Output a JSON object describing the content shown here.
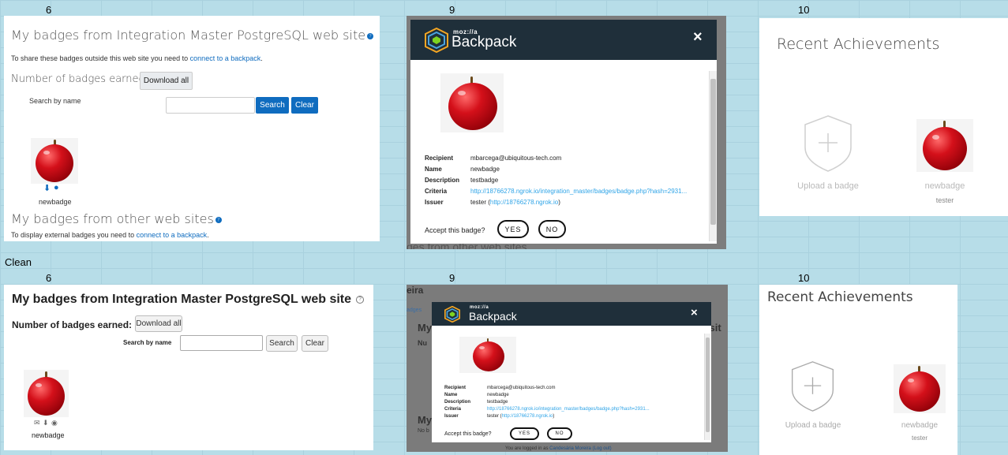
{
  "sheet": {
    "col_top": [
      "6",
      "9",
      "10"
    ],
    "col_bottom": [
      "6",
      "9",
      "10"
    ],
    "row_label": "Clean"
  },
  "boost": {
    "title": "My badges from Integration Master PostgreSQL web site",
    "share_text": "To share these badges outside this web site you need to",
    "share_link": "connect to a backpack",
    "share_end": ".",
    "earned_label": "Number of badges earned: 1",
    "download_all": "Download all",
    "search_label": "Search by name",
    "search_btn": "Search",
    "clear_btn": "Clear",
    "badge_name": "newbadge",
    "other_title": "My badges from other web sites",
    "display_text": "To display external badges you need to",
    "display_link": "connect to a backpack",
    "display_end": "."
  },
  "backpack_top": {
    "moz": "moz://a",
    "brand": "Backpack",
    "close": "×",
    "labels": {
      "recipient": "Recipient",
      "name": "Name",
      "description": "Description",
      "criteria": "Criteria",
      "issuer": "Issuer"
    },
    "recipient": "mbarcega@ubiquitous-tech.com",
    "name": "newbadge",
    "description": "testbadge",
    "criteria": "http://18766278.ngrok.io/integration_master/badges/badge.php?hash=2931...",
    "issuer_name": "tester (",
    "issuer_link": "http://18766278.ngrok.io",
    "issuer_end": ")",
    "accept_q": "Accept this badge?",
    "yes": "YES",
    "no": "NO",
    "bg_text": "ges from other web sites"
  },
  "achievements_top": {
    "title": "Recent Achievements",
    "upload": "Upload a badge",
    "badge_name": "newbadge",
    "issuer": "tester"
  },
  "clean": {
    "title": "My badges from Integration Master PostgreSQL web site",
    "earned_label": "Number of badges earned: 1",
    "download_all": "Download all",
    "search_label": "Search by name",
    "search_btn": "Search",
    "clear_btn": "Clear",
    "badge_name": "newbadge"
  },
  "backpack_clean": {
    "bg_eira": "eira",
    "bg_badges": "adges",
    "bg_my1": "My",
    "bg_nu": "Nu",
    "bg_sit": "b sit",
    "bg_my2": "My",
    "bg_no": "No b",
    "moz": "moz://a",
    "brand": "Backpack",
    "close": "×",
    "labels": {
      "recipient": "Recipient",
      "name": "Name",
      "description": "Description",
      "criteria": "Criteria",
      "issuer": "Issuer"
    },
    "recipient": "mbarcega@ubiquitous-tech.com",
    "name": "newbadge",
    "description": "testbadge",
    "criteria": "http://18766278.ngrok.io/integration_master/badges/badge.php?hash=2931...",
    "issuer_name": "tester (",
    "issuer_link": "http://18766278.ngrok.io",
    "issuer_end": ")",
    "accept_q": "Accept this badge?",
    "yes": "YES",
    "no": "NO",
    "footer_pre": "You are logged in as",
    "footer_user": "Candesária Moreira",
    "footer_logout": "(Log out)"
  },
  "achievements_clean": {
    "title": "Recent Achievements",
    "upload": "Upload a badge",
    "badge_name": "newbadge",
    "issuer": "tester"
  },
  "colors": {
    "accent": "#0f6cbf",
    "dark": "#1f2f3a",
    "background": "#b7dde8"
  }
}
